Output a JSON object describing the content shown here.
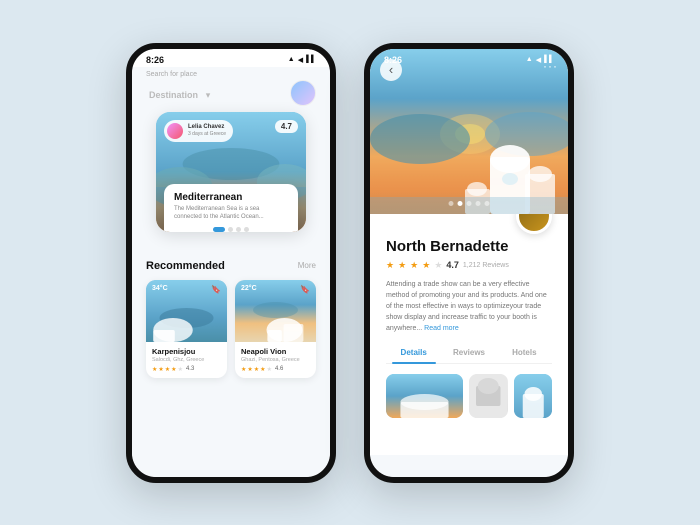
{
  "phone1": {
    "statusBar": {
      "time": "8:26",
      "icons": "▲ ◀ ▌▌"
    },
    "searchLabel": "Search for place",
    "destinationTitle": "Destination",
    "destinationArrow": "▾",
    "heroCard": {
      "userName": "Lelia Chavez",
      "userSub": "3 days at Greece",
      "rating": "4.7",
      "infoTitle": "Mediterranean",
      "infoDesc": "The Mediterranean Sea is a sea connected to the Atlantic Ocean...",
      "dots": [
        "active",
        "",
        "",
        ""
      ]
    },
    "recommended": {
      "title": "Recommended",
      "more": "More",
      "cards": [
        {
          "temp": "34°C",
          "name": "Karpenisjou",
          "location": "Salocdi, Ghz, Greece",
          "rating": "4.3",
          "stars": 4
        },
        {
          "temp": "22°C",
          "name": "Neapoli Vion",
          "location": "Ghazi, Pentosa, Greece",
          "rating": "4.6",
          "stars": 4
        }
      ]
    }
  },
  "phone2": {
    "statusBar": {
      "time": "8:26",
      "icons": "▲ ◀ ▌▌"
    },
    "backBtn": "‹",
    "menuDots": "···",
    "indicatorDots": [
      "",
      "active",
      "",
      "",
      ""
    ],
    "placeName": "North Bernadette",
    "rating": "4.7",
    "reviewCount": "1,212 Reviews",
    "stars": 4,
    "description": "Attending a trade show can be a very effective method of promoting your and its products. And one of the most effective in ways to optimizeyour trade show display and increase traffic to your booth is anywhere...",
    "readMore": "Read more",
    "tabs": [
      {
        "label": "Details",
        "active": true
      },
      {
        "label": "Reviews",
        "active": false
      },
      {
        "label": "Hotels",
        "active": false
      }
    ]
  }
}
